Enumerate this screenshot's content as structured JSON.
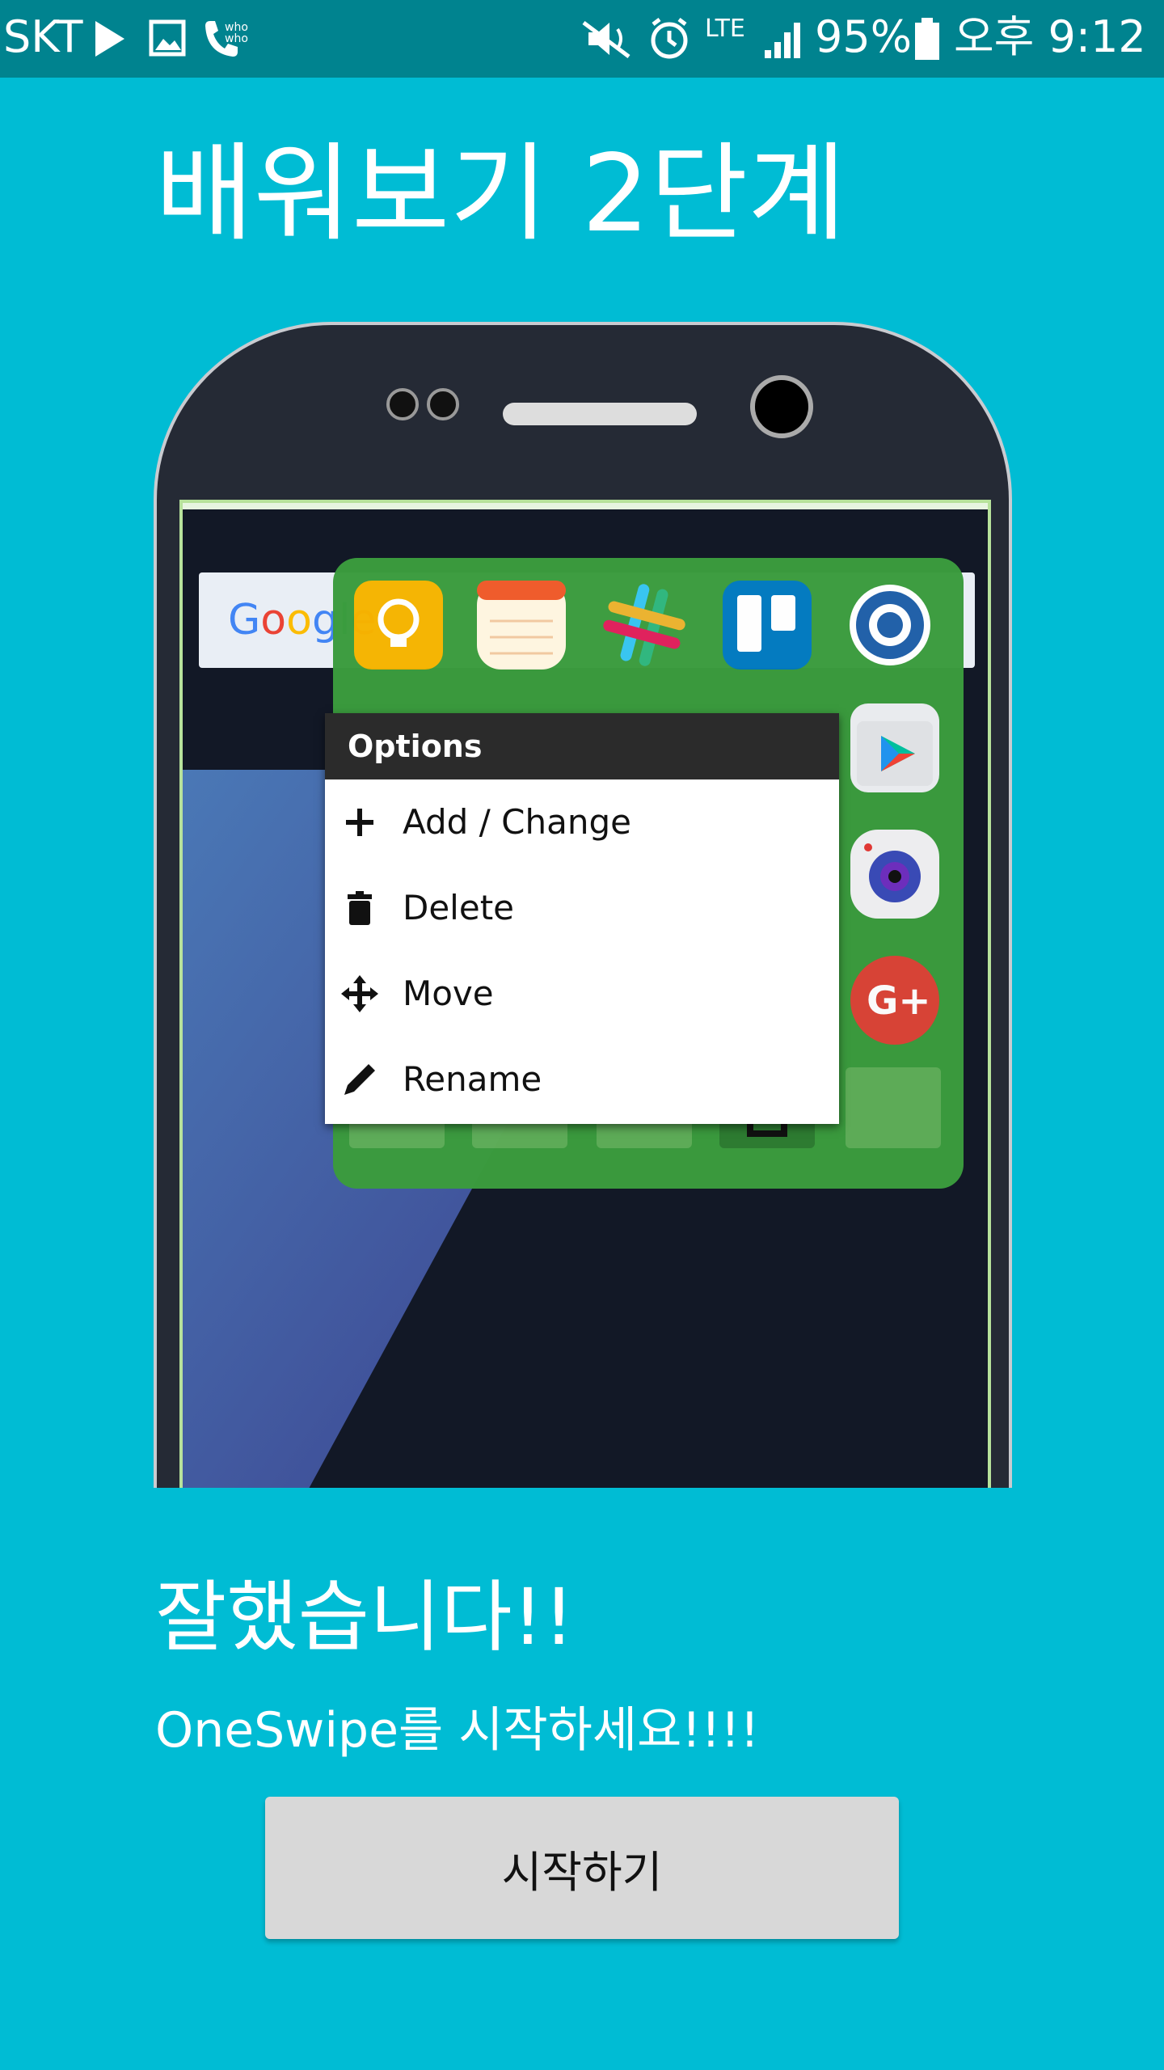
{
  "status_bar": {
    "carrier": "SKT",
    "lte": "LTE",
    "battery": "95%",
    "time": "오후 9:12",
    "icons": [
      "play-icon",
      "image-icon",
      "whowho-call-icon",
      "mute-icon",
      "alarm-icon",
      "lte-icon",
      "signal-icon",
      "battery-icon"
    ]
  },
  "page": {
    "title": "배워보기 2단계",
    "done": "잘했습니다!!",
    "subtitle": "OneSwipe를 시작하세요!!!!",
    "start_button": "시작하기"
  },
  "preview": {
    "google_label": "Google",
    "options_menu": {
      "header": "Options",
      "items": [
        {
          "label": "Add / Change",
          "icon": "plus-icon"
        },
        {
          "label": "Delete",
          "icon": "trash-icon"
        },
        {
          "label": "Move",
          "icon": "move-arrows-icon"
        },
        {
          "label": "Rename",
          "icon": "pencil-icon"
        }
      ]
    },
    "folder_apps": [
      "keep-icon",
      "memo-icon",
      "slack-icon",
      "trello-icon",
      "app-circle-icon",
      "play-store-icon",
      "camera-icon",
      "google-plus-icon"
    ]
  },
  "colors": {
    "background": "#00BCD4",
    "status_bar": "#00838F",
    "folder": "#3b9c3e",
    "button": "#d8d8d8"
  }
}
